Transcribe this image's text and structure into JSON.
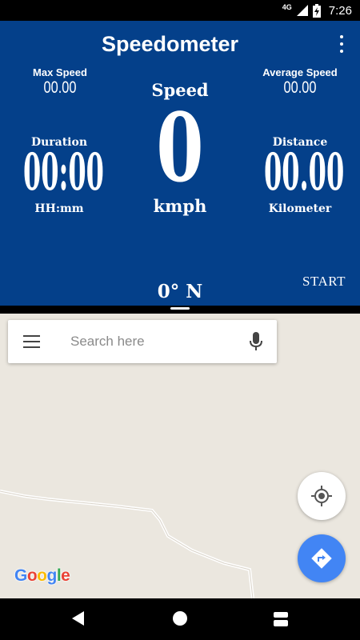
{
  "status_bar": {
    "network": "4G",
    "time": "7:26"
  },
  "header": {
    "title": "Speedometer"
  },
  "stats": {
    "max_speed": {
      "label": "Max Speed",
      "value": "00.00"
    },
    "average_speed": {
      "label": "Average Speed",
      "value": "00.00"
    },
    "speed": {
      "label": "Speed",
      "value": "0",
      "unit": "kmph"
    },
    "duration": {
      "label": "Duration",
      "value": "00:00",
      "unit": "HH:mm"
    },
    "distance": {
      "label": "Distance",
      "value": "00.00",
      "unit": "Kilometer"
    }
  },
  "controls": {
    "start_label": "START",
    "heading": "0° N"
  },
  "map": {
    "search_placeholder": "Search here",
    "logo_text": "Google",
    "logo_colors": [
      "#4285f4",
      "#ea4335",
      "#fbbc05",
      "#4285f4",
      "#34a853",
      "#ea4335"
    ]
  },
  "colors": {
    "panel": "#04408a",
    "map_bg": "#ebe7df",
    "fab_blue": "#4285f4"
  },
  "icons": [
    "signal-icon",
    "battery-icon",
    "overflow-menu-icon",
    "hamburger-menu-icon",
    "mic-icon",
    "my-location-icon",
    "directions-icon",
    "back-icon",
    "home-icon",
    "recent-apps-icon"
  ]
}
